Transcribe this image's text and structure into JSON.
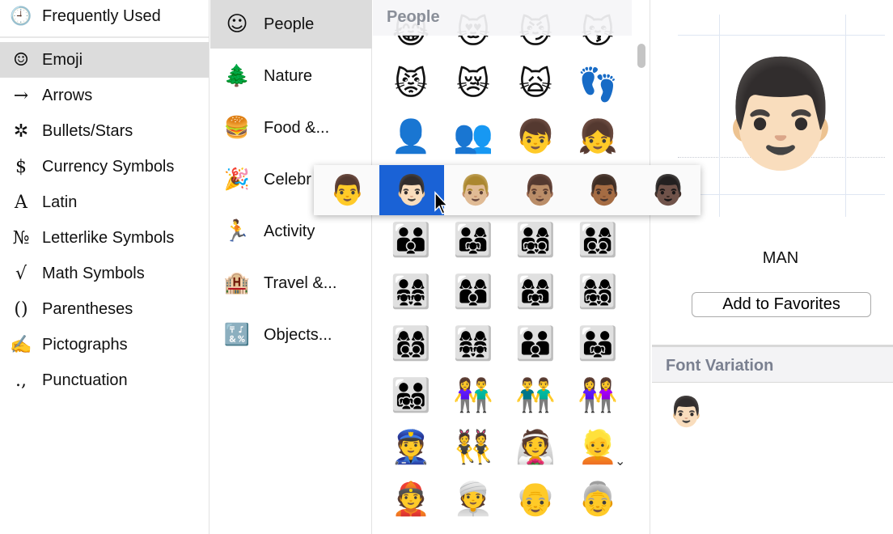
{
  "categories": [
    {
      "icon": "🕘",
      "icon_name": "clock-icon",
      "label": "Frequently Used"
    },
    {
      "icon": "☺",
      "icon_name": "smiley-icon",
      "label": "Emoji",
      "selected": true
    },
    {
      "icon": "→",
      "icon_name": "arrow-icon",
      "label": "Arrows"
    },
    {
      "icon": "✲",
      "icon_name": "asterisk-icon",
      "label": "Bullets/Stars"
    },
    {
      "icon": "$",
      "icon_name": "dollar-icon",
      "label": "Currency Symbols"
    },
    {
      "icon": "A",
      "icon_name": "latin-a-icon",
      "label": "Latin"
    },
    {
      "icon": "№",
      "icon_name": "numero-icon",
      "label": "Letterlike Symbols"
    },
    {
      "icon": "√",
      "icon_name": "sqrt-icon",
      "label": "Math Symbols"
    },
    {
      "icon": "()",
      "icon_name": "parentheses-icon",
      "label": "Parentheses"
    },
    {
      "icon": "✍",
      "icon_name": "writing-hand-icon",
      "label": "Pictographs"
    },
    {
      "icon": ".,",
      "icon_name": "punctuation-icon",
      "label": "Punctuation"
    }
  ],
  "subcategories": [
    {
      "icon": "☺",
      "icon_name": "smiley-icon",
      "label": "People",
      "selected": true
    },
    {
      "icon": "🌲",
      "icon_name": "tree-icon",
      "label": "Nature"
    },
    {
      "icon": "🍔",
      "icon_name": "food-icon",
      "label": "Food &..."
    },
    {
      "icon": "🎉",
      "icon_name": "party-popper-icon",
      "label": "Celebr"
    },
    {
      "icon": "🏃",
      "icon_name": "runner-icon",
      "label": "Activity"
    },
    {
      "icon": "🏨",
      "icon_name": "building-icon",
      "label": "Travel &..."
    },
    {
      "icon": "🔣",
      "icon_name": "symbols-icon",
      "label": "Objects..."
    }
  ],
  "grid": {
    "header": "People",
    "rows": [
      [
        "😹",
        "😻",
        "😼",
        "😽"
      ],
      [
        "😾",
        "😿",
        "🙀",
        "👣"
      ],
      [
        "👤",
        "👥",
        "👦",
        "👧"
      ],
      [
        "👨",
        "👩",
        "👪",
        "👫"
      ],
      [
        "👪",
        "👨‍👩‍👧",
        "👨‍👩‍👧‍👦",
        "👨‍👩‍👦‍👦"
      ],
      [
        "👨‍👩‍👧‍👧",
        "👩‍👩‍👦",
        "👩‍👩‍👧",
        "👩‍👩‍👧‍👦"
      ],
      [
        "👩‍👩‍👦‍👦",
        "👩‍👩‍👧‍👧",
        "👨‍👨‍👦",
        "👨‍👨‍👧"
      ],
      [
        "👨‍👨‍👧‍👦",
        "👫",
        "👬",
        "👭"
      ],
      [
        "👮",
        "👯",
        "👰",
        "👱"
      ],
      [
        "👲",
        "👳",
        "👴",
        "👵"
      ]
    ]
  },
  "skin_tone_popover": {
    "options": [
      "👨",
      "👨🏻",
      "👨🏼",
      "👨🏽",
      "👨🏾",
      "👨🏿"
    ],
    "selected_index": 1
  },
  "detail": {
    "glyph": "👨🏻",
    "name": "MAN",
    "add_favorites_label": "Add to Favorites",
    "font_variation_header": "Font Variation",
    "variations": [
      "👨🏻"
    ]
  },
  "colors": {
    "selection": "#1a62d6",
    "sidebar_selected": "#dcdcdc",
    "header_text": "#7a8090"
  }
}
